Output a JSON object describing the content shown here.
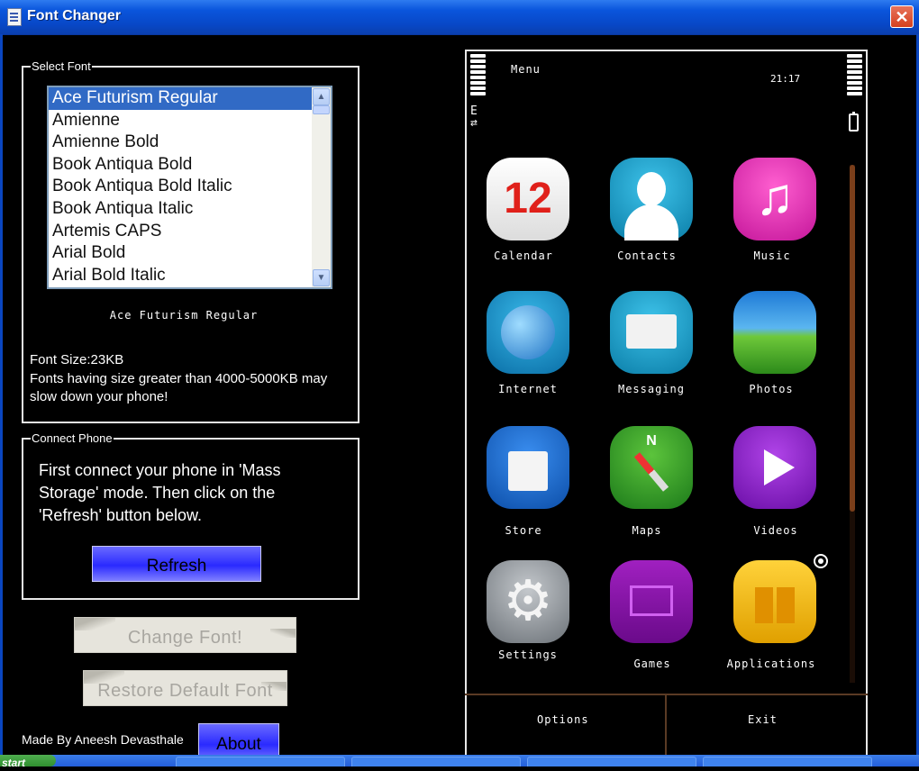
{
  "window": {
    "title": "Font Changer",
    "close_glyph": "✕"
  },
  "select_font": {
    "legend": "Select Font",
    "fonts": [
      "Ace Futurism Regular",
      "Amienne",
      "Amienne Bold",
      "Book Antiqua Bold",
      "Book Antiqua Bold Italic",
      "Book Antiqua Italic",
      "Artemis CAPS",
      "Arial Bold",
      "Arial Bold Italic"
    ],
    "selected_index": 0,
    "preview_text": "Ace Futurism Regular",
    "font_size": "Font Size:23KB",
    "warning": "Fonts having size greater than 4000-5000KB may slow down your phone!"
  },
  "connect_phone": {
    "legend": "Connect Phone",
    "instructions": "First connect your phone in 'Mass Storage' mode. Then click on the 'Refresh' button below.",
    "refresh_label": "Refresh"
  },
  "actions": {
    "change_font_label": "Change Font!",
    "restore_label": "Restore Default Font",
    "about_label": "About"
  },
  "credit": "Made By Aneesh Devasthale",
  "phone": {
    "menu_label": "Menu",
    "time": "21:17",
    "network_indicator": "E",
    "apps": [
      {
        "label": "Calendar",
        "icon": "calendar-icon",
        "badge": "12"
      },
      {
        "label": "Contacts",
        "icon": "contacts-icon"
      },
      {
        "label": "Music",
        "icon": "music-icon"
      },
      {
        "label": "Internet",
        "icon": "globe-icon"
      },
      {
        "label": "Messaging",
        "icon": "envelope-icon"
      },
      {
        "label": "Photos",
        "icon": "landscape-icon"
      },
      {
        "label": "Store",
        "icon": "shopping-bag-icon"
      },
      {
        "label": "Maps",
        "icon": "compass-icon",
        "badge": "N"
      },
      {
        "label": "Videos",
        "icon": "play-icon"
      },
      {
        "label": "Settings",
        "icon": "gear-icon"
      },
      {
        "label": "Games",
        "icon": "game-folder-icon"
      },
      {
        "label": "Applications",
        "icon": "applications-folder-icon"
      }
    ],
    "softkeys": {
      "left": "Options",
      "right": "Exit"
    }
  },
  "taskbar": {
    "start_label": "start"
  },
  "colors": {
    "titlebar": "#0a55dc",
    "selection": "#316ac5",
    "button_blue": "#2a2aff",
    "phone_scroll": "#7a3e1a"
  }
}
